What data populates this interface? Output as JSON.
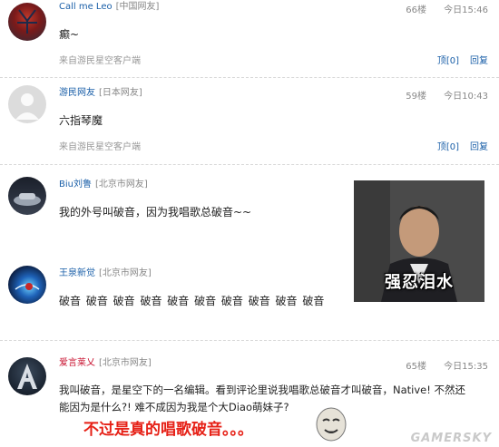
{
  "comments": [
    {
      "user": "Call me Leo",
      "location": "[中国网友]",
      "floor": "66楼",
      "time": "今日15:46",
      "content": "癫~",
      "source": "来自游民星空客户端",
      "actions": {
        "top": "顶[0]",
        "reply": "回复"
      }
    },
    {
      "user": "游民网友",
      "location": "[日本网友]",
      "floor": "59楼",
      "time": "今日10:43",
      "content": "六指琴魔",
      "source": "来自游民星空客户端",
      "actions": {
        "top": "顶[0]",
        "reply": "回复"
      }
    },
    {
      "user": "Biu刘鲁",
      "location": "[北京市网友]",
      "content": "我的外号叫破音，因为我唱歌总破音~~"
    },
    {
      "user": "王泉新觉",
      "location": "[北京市网友]",
      "content": "破音 破音 破音 破音 破音 破音 破音 破音 破音 破音"
    },
    {
      "user": "爱言莱乂",
      "location": "[北京市网友]",
      "floor": "65楼",
      "time": "今日15:35",
      "content_line1": "我叫破音，是星空下的一名编辑。看到评论里说我唱歌总破音才叫破音，Native! 不然还",
      "content_line2": "能因为是什么?! 难不成因为我是个大Diao萌妹子?"
    }
  ],
  "meme_caption": "强忍泪水",
  "overlay_text": "不过是真的唱歌破音。。。",
  "watermark": "GAMERSKY"
}
